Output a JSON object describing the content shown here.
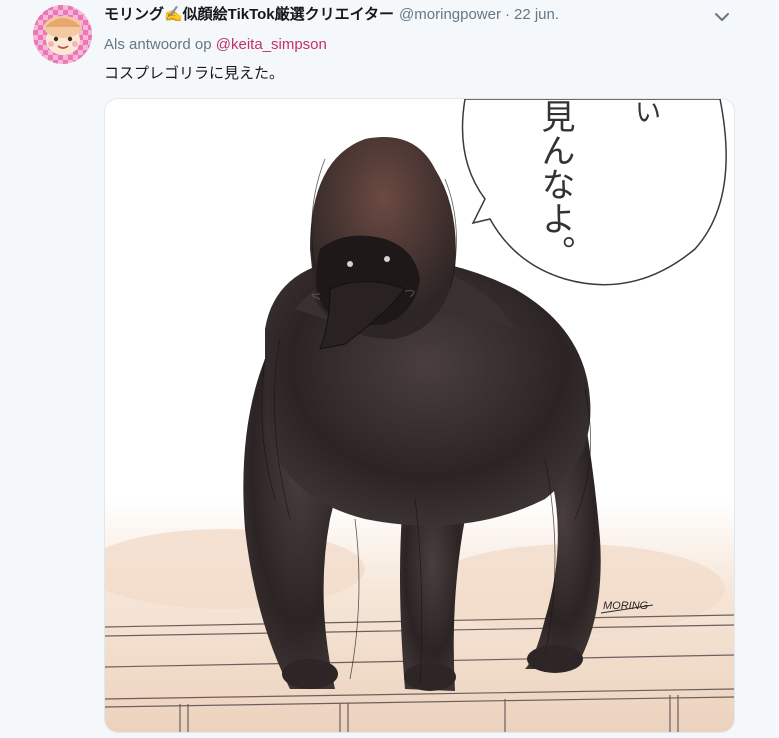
{
  "author": {
    "display_name": "モリング✍️似顔絵TikTok厳選クリエイター",
    "handle": "@moringpower",
    "separator": "·",
    "date": "22 jun."
  },
  "reply": {
    "prefix": "Als antwoord op",
    "mention": "@keita_simpson"
  },
  "tweet": {
    "text": "コスプレゴリラに見えた。"
  },
  "media": {
    "speech_bubble_text": [
      "い",
      "見んなよ。"
    ],
    "signature": "MORING"
  },
  "icons": {
    "menu": "chevron-down-icon",
    "avatar": "avatar"
  },
  "colors": {
    "background": "#f5f8fa",
    "mention": "#c1306e",
    "secondary_text": "#657786"
  }
}
